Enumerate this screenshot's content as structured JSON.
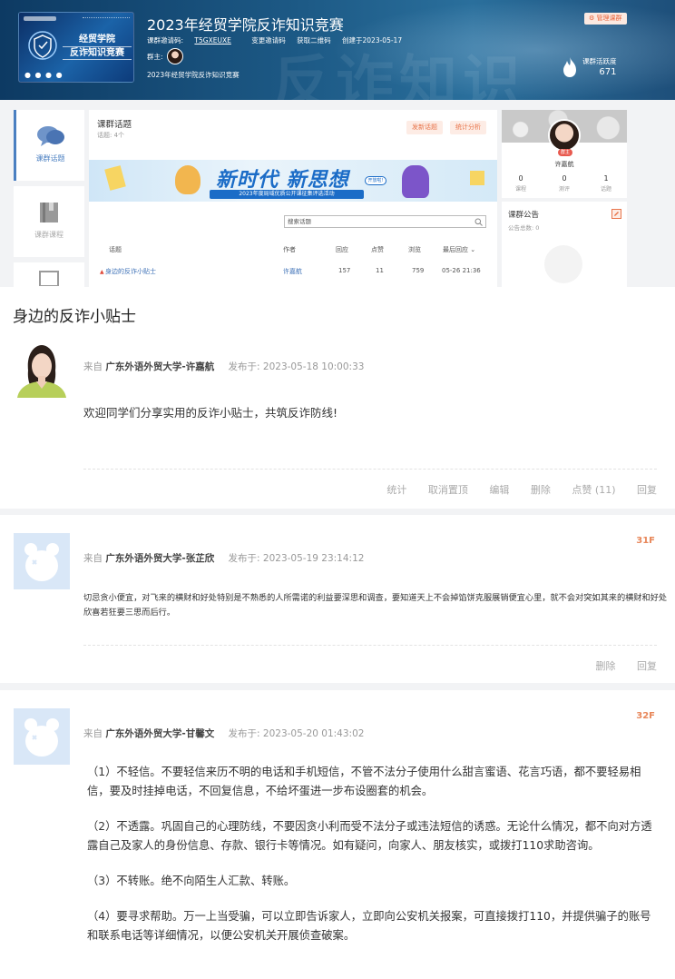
{
  "header": {
    "title": "2023年经贸学院反诈知识竞赛",
    "cover_title_line1": "经贸学院",
    "cover_title_line2": "反诈知识竞赛",
    "invite_label": "课群邀请码:",
    "invite_code": "T5GXEUXE",
    "change_code": "变更邀请码",
    "get_qr": "获取二维码",
    "created": "创建于2023-05-17",
    "owner_label": "群主:",
    "course_name": "2023年经贸学院反诈知识竞赛",
    "manage_btn": "管理课群",
    "activity_label": "课群活跃度",
    "activity_value": "671"
  },
  "side_tabs": [
    {
      "label": "课群话题",
      "icon": "chat-bubbles-icon",
      "active": true
    },
    {
      "label": "课群课程",
      "icon": "book-icon",
      "active": false
    }
  ],
  "topics": {
    "title": "课群话题",
    "count": "话题: 4个",
    "publish_btn": "发新话题",
    "stats_btn": "统计分析",
    "promo_title": "新时代 新思想",
    "promo_sub": "2023年度局域优质公开课征集评选活动",
    "promo_badge": "开放啦!",
    "search_placeholder": "搜索话题",
    "columns": [
      "话题",
      "作者",
      "回应",
      "点赞",
      "浏览",
      "最后回应"
    ],
    "rows": [
      {
        "topic": "身边的反诈小贴士",
        "author": "许嘉航",
        "replies": "157",
        "likes": "11",
        "views": "759",
        "last": "05-26 21:36"
      }
    ]
  },
  "profile": {
    "owner_tag": "群主",
    "name": "许嘉航",
    "stats": [
      {
        "value": "0",
        "label": "课程"
      },
      {
        "value": "0",
        "label": "测评"
      },
      {
        "value": "1",
        "label": "话题"
      }
    ]
  },
  "notice": {
    "title": "课群公告",
    "count": "公告总数: 0"
  },
  "thread": {
    "title": "身边的反诈小贴士",
    "main_post": {
      "from_label": "来自",
      "author": "广东外语外贸大学-许嘉航",
      "published": "发布于: 2023-05-18 10:00:33",
      "content": "欢迎同学们分享实用的反诈小贴士，共筑反诈防线!",
      "actions": [
        "统计",
        "取消置顶",
        "编辑",
        "删除",
        "点赞 (11)",
        "回复"
      ]
    },
    "replies": [
      {
        "floor": "31F",
        "from_label": "来自",
        "author": "广东外语外贸大学-张芷欣",
        "published": "发布于: 2023-05-19 23:14:12",
        "content": "切忌贪小便宜，对飞来的横财和好处特别是不熟悉的人所需诺的利益要深思和调查，要知道天上不会掉馅饼克服展销便宜心里，就不会对突如其来的横财和好处欣喜若狂要三思而后行。",
        "actions": [
          "删除",
          "回复"
        ]
      },
      {
        "floor": "32F",
        "from_label": "来自",
        "author": "广东外语外贸大学-甘馨文",
        "published": "发布于: 2023-05-20 01:43:02",
        "paragraphs": [
          "（1）不轻信。不要轻信来历不明的电话和手机短信，不管不法分子使用什么甜言蜜语、花言巧语，都不要轻易相信，要及时挂掉电话，不回复信息，不给坏蛋进一步布设圈套的机会。",
          "（2）不透露。巩固自己的心理防线，不要因贪小利而受不法分子或违法短信的诱惑。无论什么情况，都不向对方透露自己及家人的身份信息、存款、银行卡等情况。如有疑问，向家人、朋友核实，或拨打110求助咨询。",
          "（3）不转账。绝不向陌生人汇款、转账。",
          "（4）要寻求帮助。万一上当受骗，可以立即告诉家人，立即向公安机关报案，可直接拨打110，并提供骗子的账号和联系电话等详细情况，以便公安机关开展侦查破案。"
        ]
      }
    ]
  }
}
